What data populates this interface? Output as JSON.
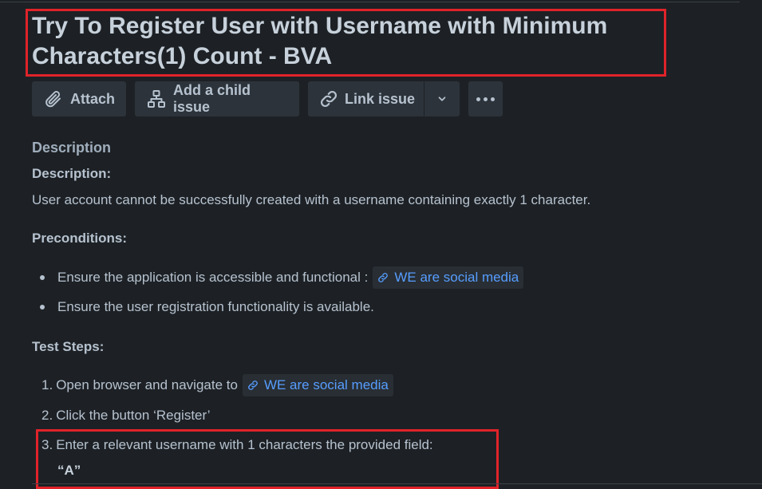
{
  "issue": {
    "title": "Try To Register User with Username with Minimum Characters(1) Count - BVA"
  },
  "toolbar": {
    "attach_label": "Attach",
    "add_child_label": "Add a child issue",
    "link_issue_label": "Link issue",
    "caret_icon": "chevron-down-icon",
    "more_icon": "more-horizontal-icon"
  },
  "description": {
    "section_label": "Description",
    "heading": "Description:",
    "text": "User account cannot be successfully created with a username containing exactly 1 character.",
    "preconditions_heading": "Preconditions:",
    "preconditions": [
      {
        "text": "Ensure the application is accessible and functional :",
        "link": "WE are social media"
      },
      {
        "text": "Ensure the user registration functionality is available."
      }
    ],
    "steps_heading": "Test Steps:",
    "steps": [
      {
        "num": "1.",
        "text": "Open browser and navigate to",
        "link": "WE are social media"
      },
      {
        "num": "2.",
        "text": "Click the button ‘Register’"
      },
      {
        "num": "3.",
        "text": "Enter a relevant username with 1 characters the provided field:",
        "value": "“A”"
      }
    ]
  },
  "colors": {
    "background": "#1d2125",
    "text": "#b6c2cf",
    "link": "#579dff",
    "highlight_box": "#e0232a",
    "button_bg": "#2c333a"
  }
}
